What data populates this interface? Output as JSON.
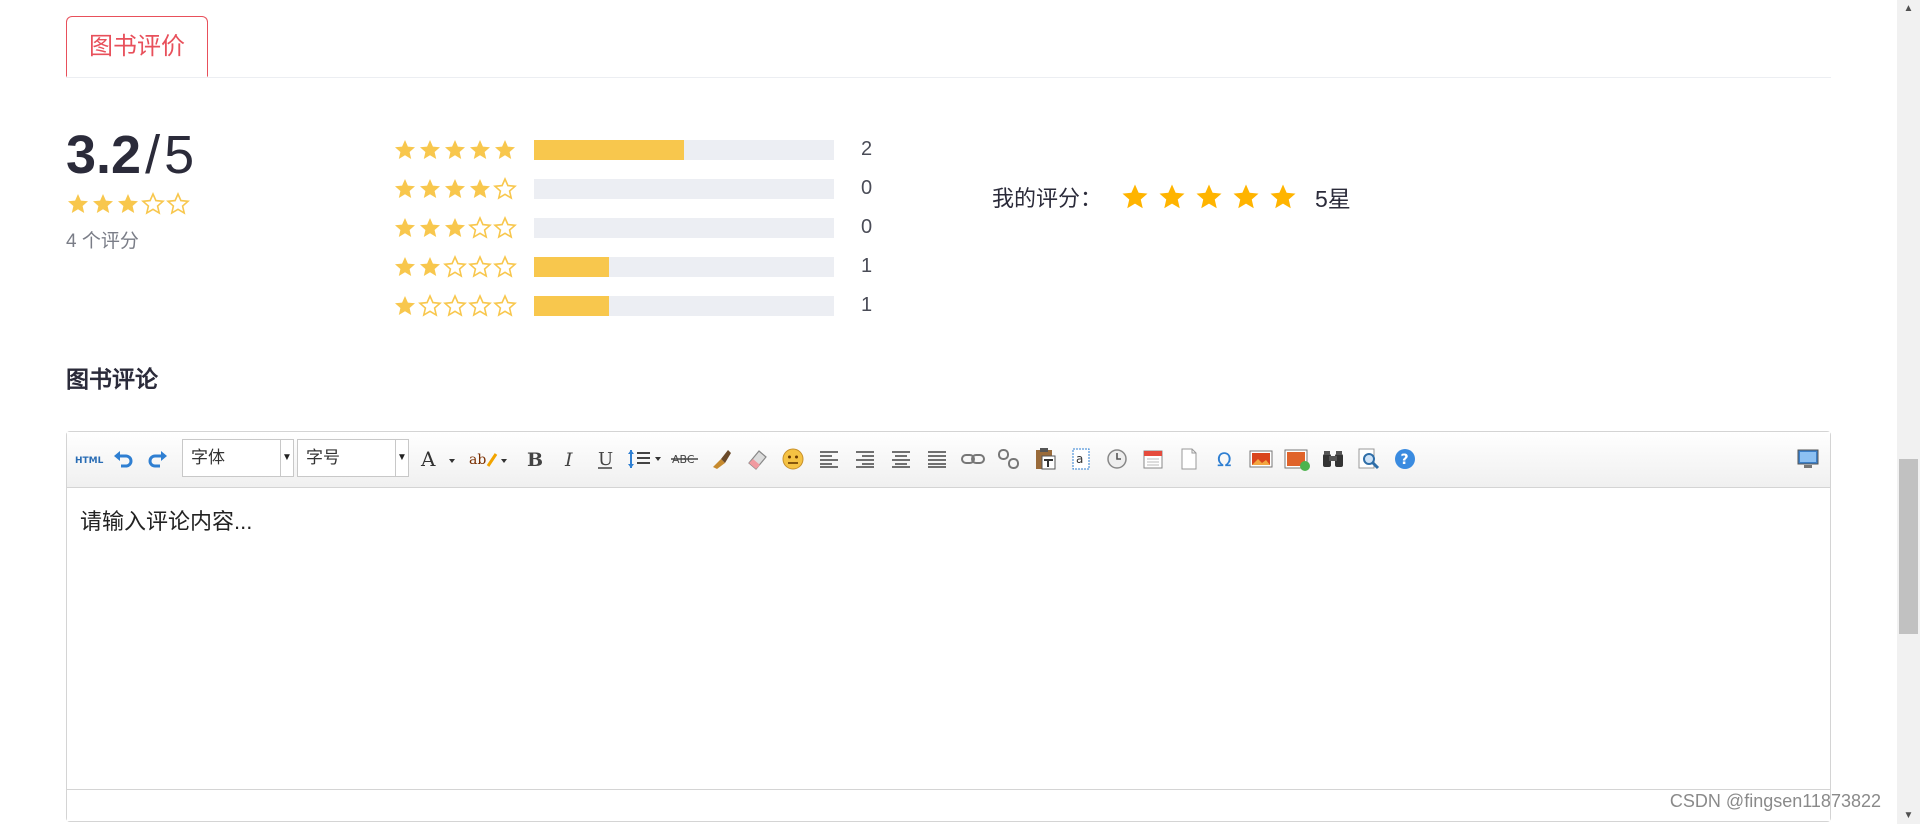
{
  "tabs": [
    {
      "label": "图书评价",
      "active": true
    }
  ],
  "summary": {
    "score": "3.2",
    "separator": "/",
    "max": "5",
    "stars_filled": 3,
    "stars_total": 5,
    "count_text": "4 个评分"
  },
  "distribution": [
    {
      "stars": 5,
      "count": "2",
      "fraction": 0.5
    },
    {
      "stars": 4,
      "count": "0",
      "fraction": 0
    },
    {
      "stars": 3,
      "count": "0",
      "fraction": 0
    },
    {
      "stars": 2,
      "count": "1",
      "fraction": 0.25
    },
    {
      "stars": 1,
      "count": "1",
      "fraction": 0.25
    }
  ],
  "my_rating": {
    "label": "我的评分：",
    "stars": 5,
    "value_text": "5星"
  },
  "comment": {
    "heading": "图书评论",
    "placeholder": "请输入评论内容..."
  },
  "editor": {
    "font_family_label": "字体",
    "font_size_label": "字号",
    "toolbar_icons": [
      "html-source-icon",
      "undo-icon",
      "redo-icon",
      "font-color-icon",
      "highlight-icon",
      "bold-icon",
      "italic-icon",
      "underline-icon",
      "line-height-icon",
      "strikethrough-icon",
      "format-brush-icon",
      "eraser-icon",
      "emoticon-icon",
      "align-left-icon",
      "align-right-icon",
      "align-center-icon",
      "align-justify-icon",
      "link-icon",
      "unlink-icon",
      "paste-icon",
      "paste-text-icon",
      "special-anchor-icon",
      "time-icon",
      "date-icon",
      "new-page-icon",
      "omega-icon",
      "image-icon",
      "insert-image-icon",
      "find-icon",
      "preview-icon",
      "help-icon",
      "fullscreen-icon"
    ]
  },
  "colors": {
    "accent": "#e8505b",
    "star": "#f8c74d",
    "my_star": "#ffb400"
  },
  "watermark": "CSDN @fingsen11873822"
}
